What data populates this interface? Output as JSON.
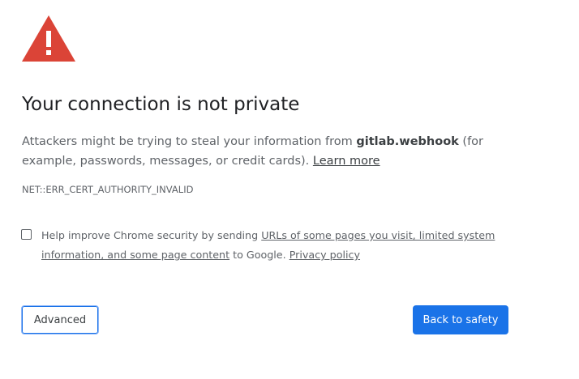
{
  "interstitial": {
    "heading": "Your connection is not private",
    "explanation_prefix": "Attackers might be trying to steal your information from ",
    "host": "gitlab.webhook",
    "explanation_suffix": " (for example, passwords, messages, or credit cards). ",
    "learn_more": "Learn more",
    "error_code": "NET::ERR_CERT_AUTHORITY_INVALID",
    "warning_icon": "warning-triangle-icon",
    "accent_color": "#db4437"
  },
  "optin": {
    "checked": false,
    "text_prefix": "Help improve Chrome security by sending ",
    "link_text": "URLs of some pages you visit, limited system information, and some page content",
    "text_middle": " to Google. ",
    "privacy_link": "Privacy policy"
  },
  "buttons": {
    "advanced": "Advanced",
    "back_to_safety": "Back to safety",
    "primary_color": "#1a73e8"
  }
}
